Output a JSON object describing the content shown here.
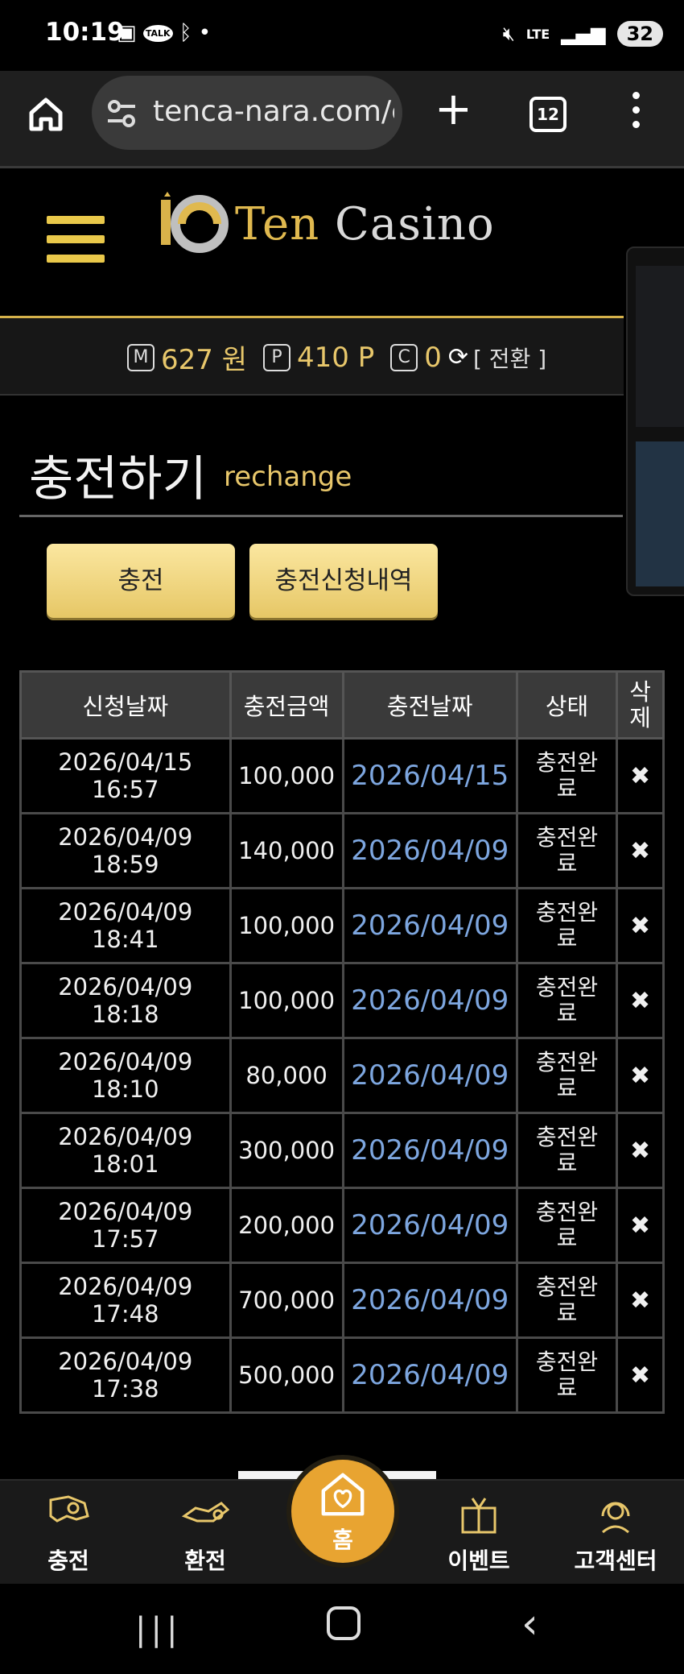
{
  "status_bar": {
    "time": "10:19",
    "network": "LTE",
    "battery": "32",
    "icons": [
      "screenshot-icon",
      "kakaotalk-icon",
      "bluetooth-icon",
      "mute-icon",
      "signal-icon"
    ]
  },
  "browser": {
    "url": "tenca-nara.com/c",
    "tab_count": "12"
  },
  "site": {
    "logo_text_1": "Ten",
    "logo_text_2": "Casino"
  },
  "balance": {
    "m_label": "M",
    "money": "627 원",
    "p_label": "P",
    "points": "410 P",
    "c_label": "C",
    "coins": "0",
    "switch_label": "[ 전환 ]"
  },
  "page": {
    "title": "충전하기",
    "subtitle": "rechange"
  },
  "buttons": {
    "charge": "충전",
    "history": "충전신청내역"
  },
  "table": {
    "headers": [
      "신청날짜",
      "충전금액",
      "충전날짜",
      "상태",
      "삭제"
    ],
    "rows": [
      {
        "req_date": "2026/04/15",
        "req_time": "16:57",
        "amount": "100,000",
        "charge_date": "2026/04/15",
        "status_1": "충전완",
        "status_2": "료"
      },
      {
        "req_date": "2026/04/09",
        "req_time": "18:59",
        "amount": "140,000",
        "charge_date": "2026/04/09",
        "status_1": "충전완",
        "status_2": "료"
      },
      {
        "req_date": "2026/04/09",
        "req_time": "18:41",
        "amount": "100,000",
        "charge_date": "2026/04/09",
        "status_1": "충전완",
        "status_2": "료"
      },
      {
        "req_date": "2026/04/09",
        "req_time": "18:18",
        "amount": "100,000",
        "charge_date": "2026/04/09",
        "status_1": "충전완",
        "status_2": "료"
      },
      {
        "req_date": "2026/04/09",
        "req_time": "18:10",
        "amount": "80,000",
        "charge_date": "2026/04/09",
        "status_1": "충전완",
        "status_2": "료"
      },
      {
        "req_date": "2026/04/09",
        "req_time": "18:01",
        "amount": "300,000",
        "charge_date": "2026/04/09",
        "status_1": "충전완",
        "status_2": "료"
      },
      {
        "req_date": "2026/04/09",
        "req_time": "17:57",
        "amount": "200,000",
        "charge_date": "2026/04/09",
        "status_1": "충전완",
        "status_2": "료"
      },
      {
        "req_date": "2026/04/09",
        "req_time": "17:48",
        "amount": "700,000",
        "charge_date": "2026/04/09",
        "status_1": "충전완",
        "status_2": "료"
      },
      {
        "req_date": "2026/04/09",
        "req_time": "17:38",
        "amount": "500,000",
        "charge_date": "2026/04/09",
        "status_1": "충전완",
        "status_2": "료"
      }
    ],
    "delete_symbol": "✖"
  },
  "bottom_nav": {
    "charge": "충전",
    "exchange": "환전",
    "home": "홈",
    "event": "이벤트",
    "support": "고객센터"
  },
  "colors": {
    "gold": "#e8c76b",
    "button_gold": "#f1d77f",
    "link_blue": "#7da6df",
    "home_orange": "#e8a431"
  }
}
